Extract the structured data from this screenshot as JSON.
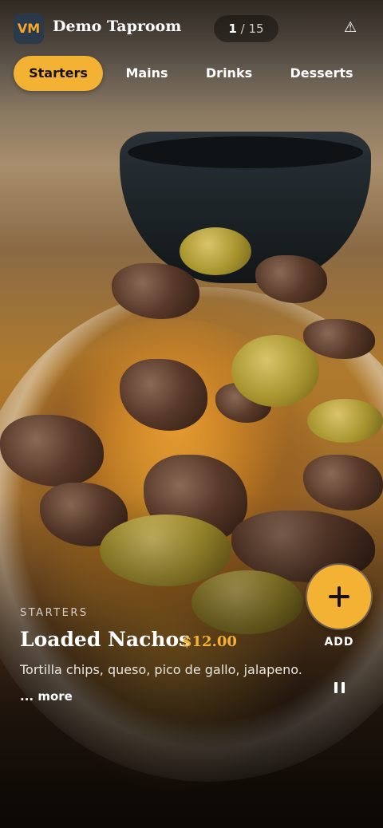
{
  "header": {
    "logo_text": "VM",
    "brand": "Demo Taproom",
    "counter": {
      "current": "1",
      "separator": "/",
      "total": "15"
    },
    "warning_icon": "⚠"
  },
  "tabs": [
    {
      "label": "Starters",
      "active": true
    },
    {
      "label": "Mains",
      "active": false
    },
    {
      "label": "Drinks",
      "active": false
    },
    {
      "label": "Desserts",
      "active": false
    }
  ],
  "item": {
    "category": "STARTERS",
    "title": "Loaded Nachos",
    "price": "$12.00",
    "description": "Tortilla chips, queso, pico de gallo, jalapeno.",
    "more_label": "... more"
  },
  "actions": {
    "add_label": "ADD",
    "add_icon": "plus-icon",
    "pause_icon": "pause-icon"
  },
  "colors": {
    "accent": "#f3b233",
    "logo_bg": "#2b3a4a",
    "logo_text": "#f5a623"
  }
}
